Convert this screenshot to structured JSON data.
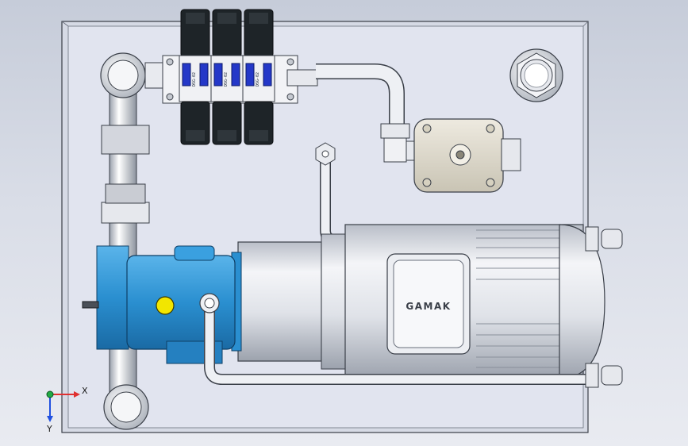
{
  "scene": {
    "motor_brand_label": "GAMAK",
    "valve_tag_text": "DSG-02",
    "colors": {
      "background_top": "#c6ccd9",
      "background_bottom": "#e9ebf1",
      "base_plate": "#e1e4ef",
      "pump_blue": "#2a8fd0",
      "pipe_light": "#eef0f4",
      "valve_body_dark": "#1e2428",
      "solenoid_blue": "#2438c8",
      "indicator_yellow": "#f2e600"
    }
  },
  "triad": {
    "x_label": "X",
    "y_label": "Y",
    "colors": {
      "x": "#e03030",
      "y": "#2050e0",
      "origin": "#22aa44"
    }
  }
}
